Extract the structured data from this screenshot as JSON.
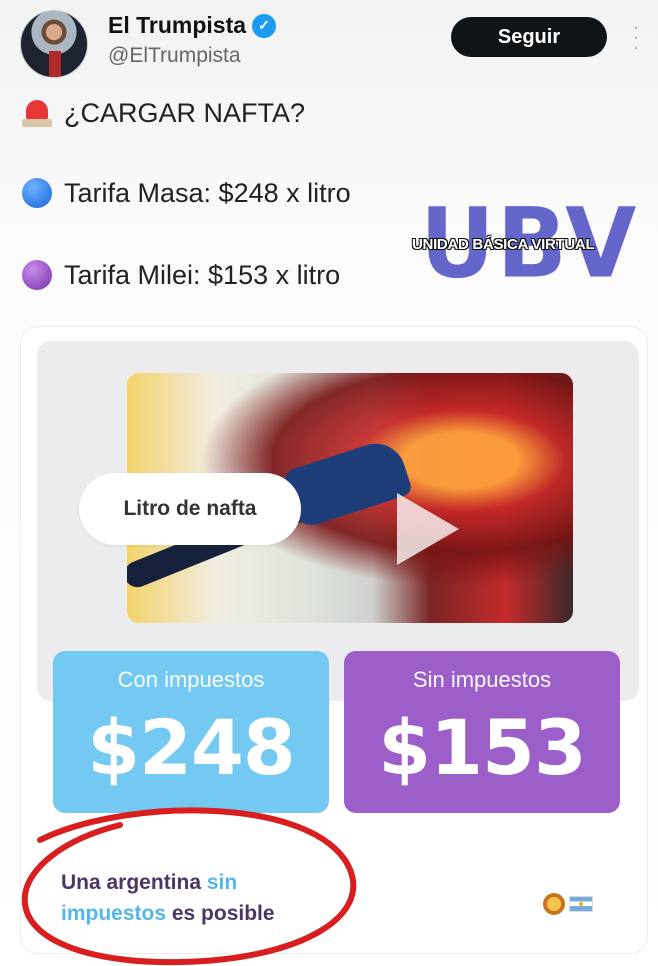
{
  "header": {
    "name": "El Trumpista",
    "handle": "@ElTrumpista",
    "follow_label": "Seguir"
  },
  "tweet": {
    "line1": "¿CARGAR NAFTA?",
    "line2": "Tarifa Masa: $248 x litro",
    "line3": "Tarifa Milei: $153 x litro"
  },
  "watermark": {
    "letters": "UBV",
    "subtitle": "UNIDAD BÁSICA VIRTUAL"
  },
  "media": {
    "pill_label": "Litro de nafta",
    "con_label": "Con impuestos",
    "con_value": "$248",
    "sin_label": "Sin impuestos",
    "sin_value": "$153",
    "slogan_part1": "Una argentina ",
    "slogan_hl1": "sin",
    "slogan_hl2": "impuestos",
    "slogan_part2": " es posible"
  },
  "colors": {
    "con_box": "#73c9f2",
    "sin_box": "#9c5fca",
    "circle_annotation": "#d81e1e",
    "verified": "#1d9bf0"
  },
  "icons": [
    "verified-icon",
    "more-options-icon",
    "siren-icon",
    "blue-circle-icon",
    "purple-circle-icon",
    "play-icon",
    "lion-icon",
    "argentina-flag-icon"
  ]
}
